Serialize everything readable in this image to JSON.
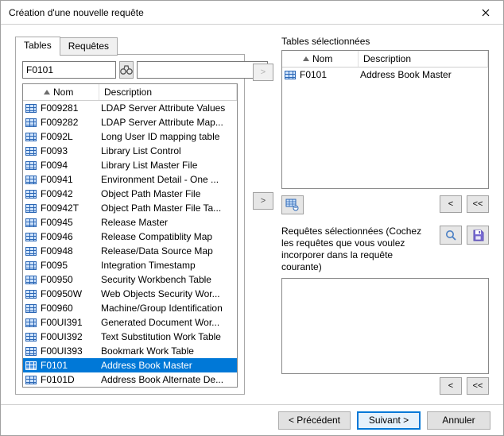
{
  "window": {
    "title": "Création d'une nouvelle requête"
  },
  "tabs": {
    "tables": "Tables",
    "queries": "Requêtes"
  },
  "search": {
    "value": "F0101",
    "filter_value": ""
  },
  "columns": {
    "name": "Nom",
    "description": "Description"
  },
  "icons": {
    "binoculars": "binoculars-icon",
    "table_link": "table-link-icon",
    "magnifier": "magnifier-icon",
    "save": "save-icon"
  },
  "move_buttons": {
    "add_disabled": ">",
    "add": ">",
    "remove": "<",
    "remove_all": "<<"
  },
  "selected_tables_label": "Tables sélectionnées",
  "selected_tables": [
    {
      "name": "F0101",
      "description": "Address Book Master"
    }
  ],
  "selected_queries_label": "Requêtes sélectionnées (Cochez les requêtes que vous voulez incorporer dans la requête courante)",
  "footer": {
    "previous": "< Précédent",
    "next": "Suivant >",
    "cancel": "Annuler"
  },
  "rows": [
    {
      "name": "F009281",
      "description": "LDAP Server Attribute Values"
    },
    {
      "name": "F009282",
      "description": "LDAP Server Attribute Map..."
    },
    {
      "name": "F0092L",
      "description": "Long User ID mapping table"
    },
    {
      "name": "F0093",
      "description": "Library List Control"
    },
    {
      "name": "F0094",
      "description": "Library List Master File"
    },
    {
      "name": "F00941",
      "description": "Environment Detail - One ..."
    },
    {
      "name": "F00942",
      "description": "Object Path Master File"
    },
    {
      "name": "F00942T",
      "description": "Object Path Master File Ta..."
    },
    {
      "name": "F00945",
      "description": "Release Master"
    },
    {
      "name": "F00946",
      "description": "Release Compatiblity Map"
    },
    {
      "name": "F00948",
      "description": "Release/Data Source Map"
    },
    {
      "name": "F0095",
      "description": "Integration Timestamp"
    },
    {
      "name": "F00950",
      "description": "Security Workbench Table"
    },
    {
      "name": "F00950W",
      "description": "Web Objects Security Wor..."
    },
    {
      "name": "F00960",
      "description": "Machine/Group Identification"
    },
    {
      "name": "F00UI391",
      "description": "Generated Document Wor..."
    },
    {
      "name": "F00UI392",
      "description": "Text Substitution Work Table"
    },
    {
      "name": "F00UI393",
      "description": "Bookmark Work Table"
    },
    {
      "name": "F0101",
      "description": "Address Book Master",
      "selected": true
    },
    {
      "name": "F0101D",
      "description": "Address Book Alternate De..."
    }
  ]
}
